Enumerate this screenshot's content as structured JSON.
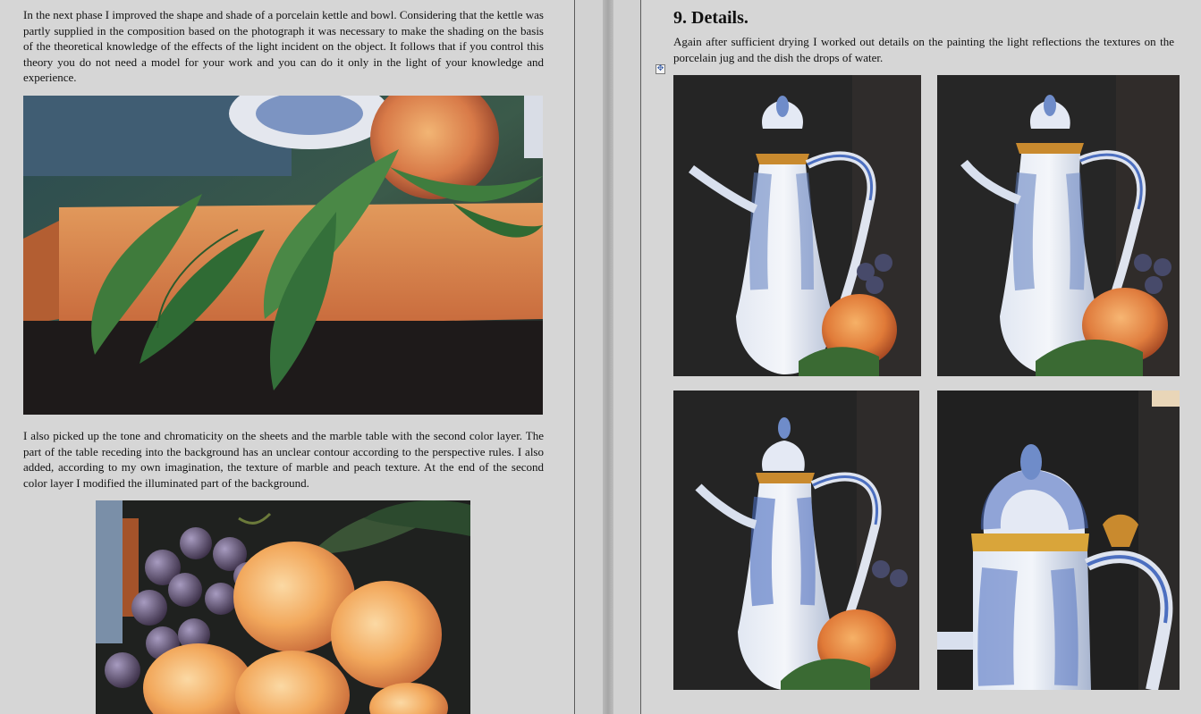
{
  "left_page": {
    "paragraph_1": "In the next phase I improved the shape and shade of a porcelain kettle and bowl. Considering that the kettle was partly supplied in the composition based on the photograph it was necessary to make the shading on the basis of the theoretical knowledge of the effects of the light incident on the object. It follows that if you control this theory you do not need a model for your work and you can do it only in the light of your knowledge and experience.",
    "paragraph_2": "I also picked up the tone and chromaticity on the sheets and the marble table with the second color layer. The part of the table receding into the background has an unclear contour according to the perspective rules. I also added, according to my own imagination, the texture of marble and peach texture. At the end of the second color layer I modified the illuminated part of the background."
  },
  "right_page": {
    "heading": "9. Details.",
    "paragraph_1": "Again after sufficient drying I worked out details on the painting the light reflections the textures on the porcelain jug and the dish the drops of water."
  },
  "icons": {
    "table_move_handle": "move-arrows-icon"
  },
  "colors": {
    "page_background": "#d6d6d6",
    "text": "#111111"
  }
}
